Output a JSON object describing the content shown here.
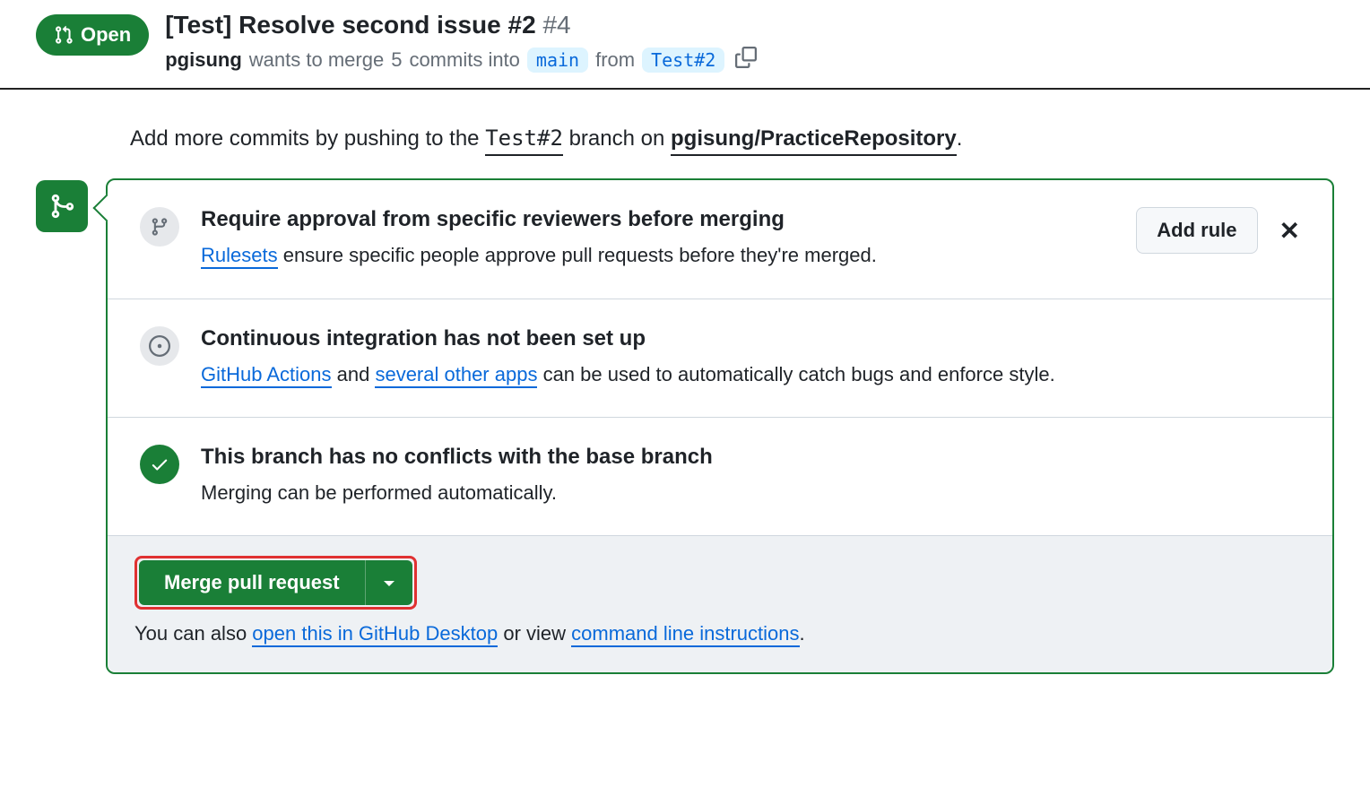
{
  "header": {
    "state_label": "Open",
    "title": "[Test] Resolve second issue #2",
    "pr_number": "#4",
    "author": "pgisung",
    "meta_before": "wants to merge",
    "commit_count": "5",
    "meta_commits_word": "commits into",
    "base_branch": "main",
    "meta_from": "from",
    "head_branch": "Test#2"
  },
  "push_hint": {
    "prefix": "Add more commits by pushing to the",
    "branch": "Test#2",
    "middle": "branch on",
    "repo": "pgisung/PracticeRepository",
    "suffix": "."
  },
  "sections": {
    "approval": {
      "title": "Require approval from specific reviewers before merging",
      "link_text": "Rulesets",
      "desc_rest": " ensure specific people approve pull requests before they're merged.",
      "add_rule_label": "Add rule"
    },
    "ci": {
      "title": "Continuous integration has not been set up",
      "link1": "GitHub Actions",
      "mid1": " and ",
      "link2": "several other apps",
      "rest": " can be used to automatically catch bugs and enforce style."
    },
    "conflicts": {
      "title": "This branch has no conflicts with the base branch",
      "desc": "Merging can be performed automatically."
    }
  },
  "footer": {
    "merge_button": "Merge pull request",
    "text_before": "You can also ",
    "link1": "open this in GitHub Desktop",
    "mid": " or view ",
    "link2": "command line instructions",
    "suffix": "."
  }
}
